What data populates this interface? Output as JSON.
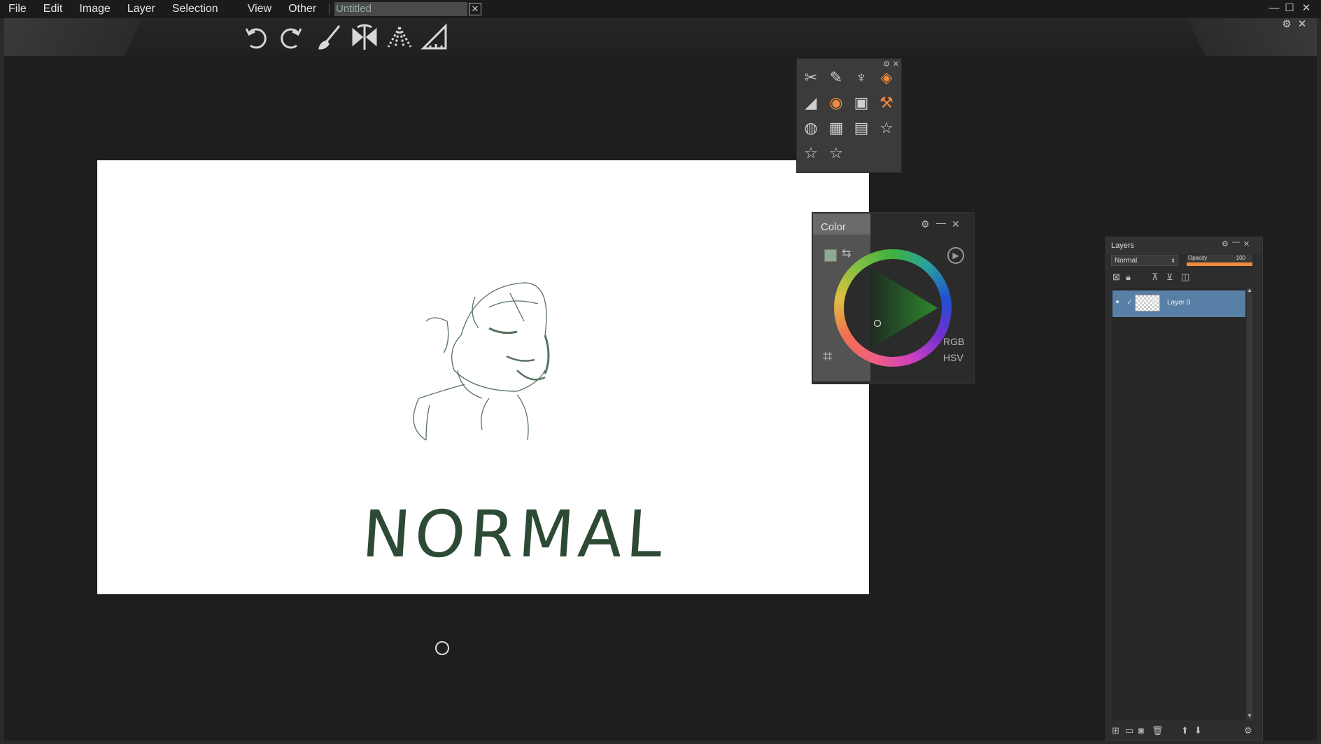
{
  "menu": {
    "items": [
      "File",
      "Edit",
      "Image",
      "Layer",
      "Selection",
      "View",
      "Other"
    ]
  },
  "document": {
    "tab_title": "Untitled",
    "close_glyph": "✕"
  },
  "window_controls": {
    "minimize": "—",
    "maximize": "☐",
    "close": "✕",
    "settings": "⚙",
    "close2": "✕"
  },
  "toolbar": {
    "icons": [
      "undo-icon",
      "redo-icon",
      "brush-icon",
      "symmetry-icon",
      "perspective-icon",
      "ruler-icon"
    ]
  },
  "canvas": {
    "text": "NORMAL"
  },
  "toolbox": {
    "icons": [
      "tools-icon",
      "brush-settings-icon",
      "brush-cup-icon",
      "layers-icon",
      "gradient-icon",
      "color-icon",
      "image-icon",
      "hammer-icon",
      "palette-icon",
      "grid-icon",
      "notes-icon",
      "star-icon",
      "star-icon",
      "star-icon"
    ],
    "active": [
      3,
      5,
      7
    ]
  },
  "color_panel": {
    "title": "Color",
    "mode_rgb": "RGB",
    "mode_hsv": "HSV",
    "current_color": "#2e6a35"
  },
  "layers_panel": {
    "title": "Layers",
    "blend_mode": "Normal",
    "opacity_label": "Opacity",
    "opacity_value": "100",
    "layers": [
      {
        "name": "Layer 0",
        "visible": true,
        "selected": true
      }
    ]
  },
  "colors": {
    "accent": "#f08a3c",
    "selection": "#587fa6",
    "canvas_ink": "#2c4a34"
  }
}
